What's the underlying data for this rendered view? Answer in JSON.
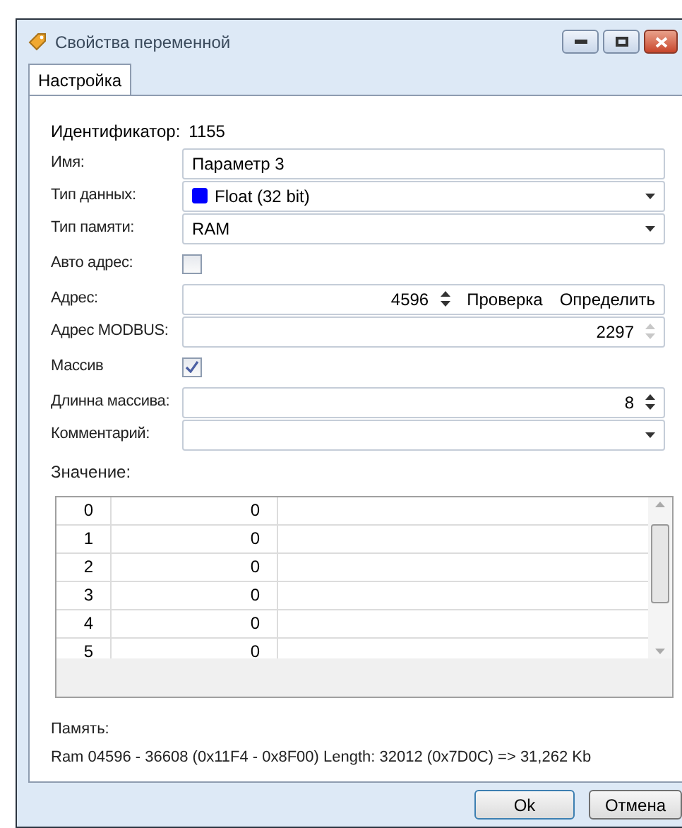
{
  "window": {
    "title": "Свойства переменной"
  },
  "tabs": [
    {
      "label": "Настройка",
      "selected": true
    }
  ],
  "identifier": {
    "label": "Идентификатор:",
    "value": "1155"
  },
  "fields": [
    {
      "kind": "text",
      "label": "Имя:",
      "value": "Параметр 3"
    },
    {
      "kind": "select",
      "label": "Тип данных:",
      "value": "Float (32 bit)",
      "color": "#0000ff"
    },
    {
      "kind": "select",
      "label": "Тип памяти:",
      "value": "RAM"
    },
    {
      "kind": "checkbox",
      "label": "Авто адрес:",
      "checked": false
    },
    {
      "kind": "spinner",
      "label": "Адрес:",
      "value": "4596",
      "disabled": false,
      "links": [
        "Проверка",
        "Определить"
      ]
    },
    {
      "kind": "spinner",
      "label": "Адрес MODBUS:",
      "value": "2297",
      "disabled": true
    },
    {
      "kind": "checkbox",
      "label": "Массив",
      "checked": true
    },
    {
      "kind": "spinner",
      "label": "Длинна массива:",
      "value": "8",
      "disabled": false
    },
    {
      "kind": "select",
      "label": "Комментарий:"
    }
  ],
  "values_label": "Значение:",
  "table": {
    "rows": [
      [
        "0",
        "0"
      ],
      [
        "1",
        "0"
      ],
      [
        "2",
        "0"
      ],
      [
        "3",
        "0"
      ],
      [
        "4",
        "0"
      ],
      [
        "5",
        "0"
      ]
    ]
  },
  "memory": {
    "label": "Память:",
    "text": "Ram 04596 - 36608 (0x11F4 - 0x8F00) Length: 32012 (0x7D0C) => 31,262 Kb"
  },
  "buttons": [
    "Ok",
    "Отмена"
  ]
}
